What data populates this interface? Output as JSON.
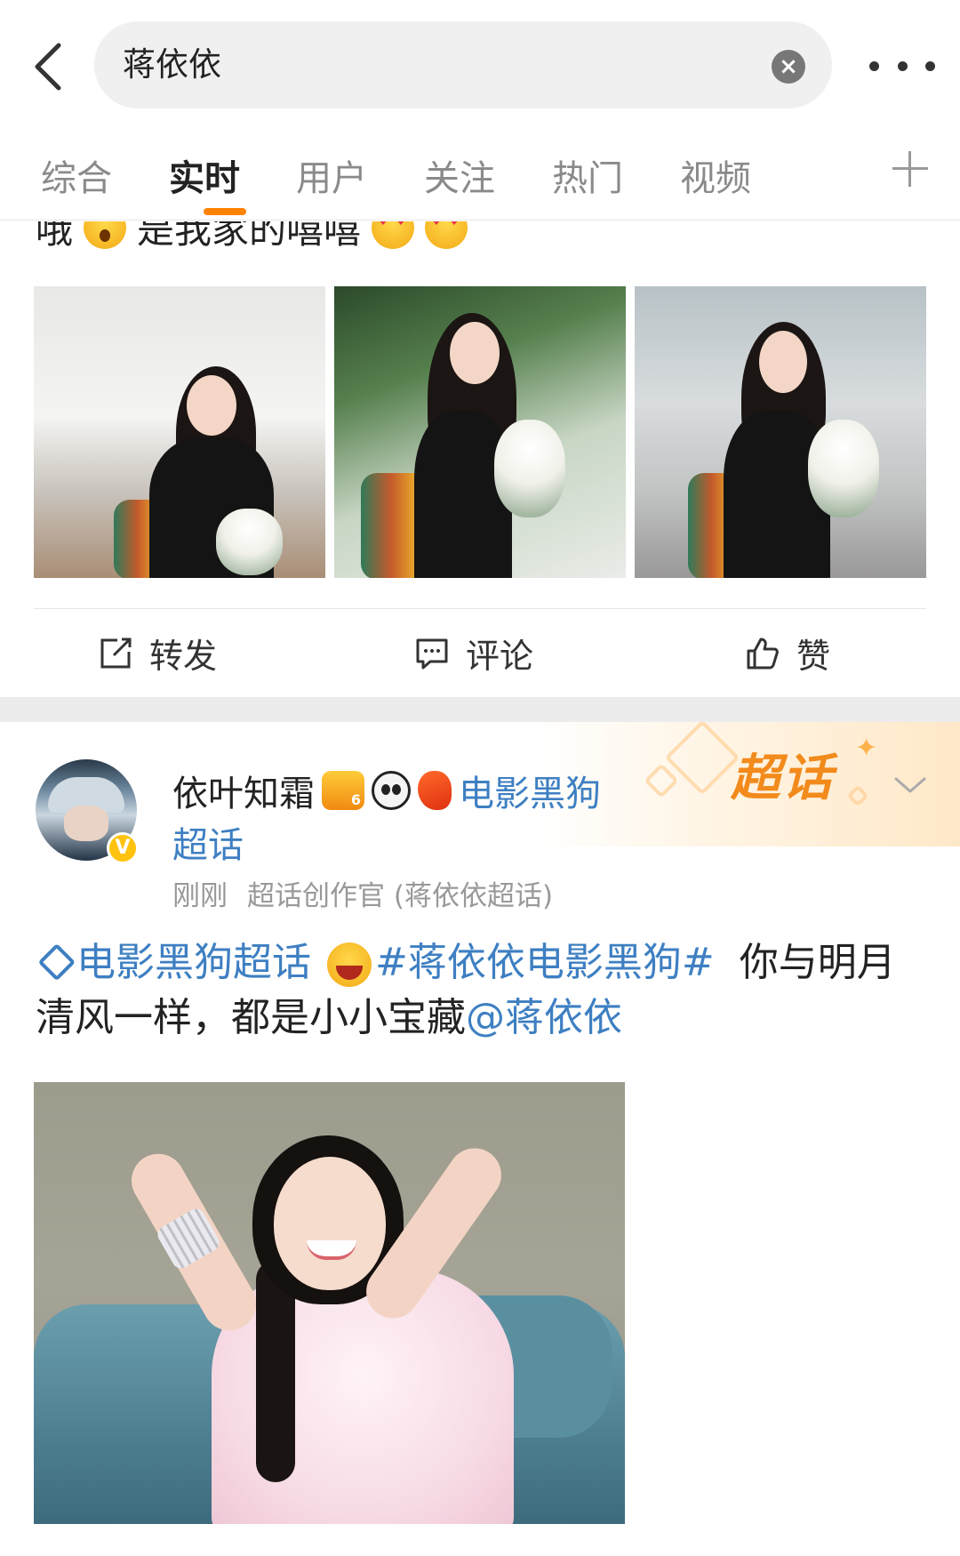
{
  "search": {
    "query": "蒋依依"
  },
  "tabs": [
    "综合",
    "实时",
    "用户",
    "关注",
    "热门",
    "视频"
  ],
  "active_tab_index": 1,
  "post1": {
    "text_visible": "哦",
    "text_after_emoji": "是我家的嘻嘻",
    "photo_count": 3,
    "actions": {
      "repost": "转发",
      "comment": "评论",
      "like": "赞"
    }
  },
  "post2": {
    "tag_label": "超话",
    "author": "依叶知霜",
    "topic_name": "电影黑狗",
    "topic_suffix": "超话",
    "time": "刚刚",
    "source": "超话创作官 (蒋依依超话)",
    "text_topic": "电影黑狗超话",
    "text_hashtag": "#蒋依依电影黑狗#",
    "text_body": "你与明月清风一样，都是小小宝藏",
    "text_mention": "@蒋依依"
  },
  "colors": {
    "accent_orange": "#ff8200",
    "link_blue": "#3e7fc2",
    "verified_gold": "#ffc20e"
  },
  "icons": [
    "back-arrow-icon",
    "clear-icon",
    "more-icon",
    "plus-icon",
    "repost-icon",
    "comment-icon",
    "like-icon",
    "chevron-down-icon",
    "verified-icon"
  ]
}
